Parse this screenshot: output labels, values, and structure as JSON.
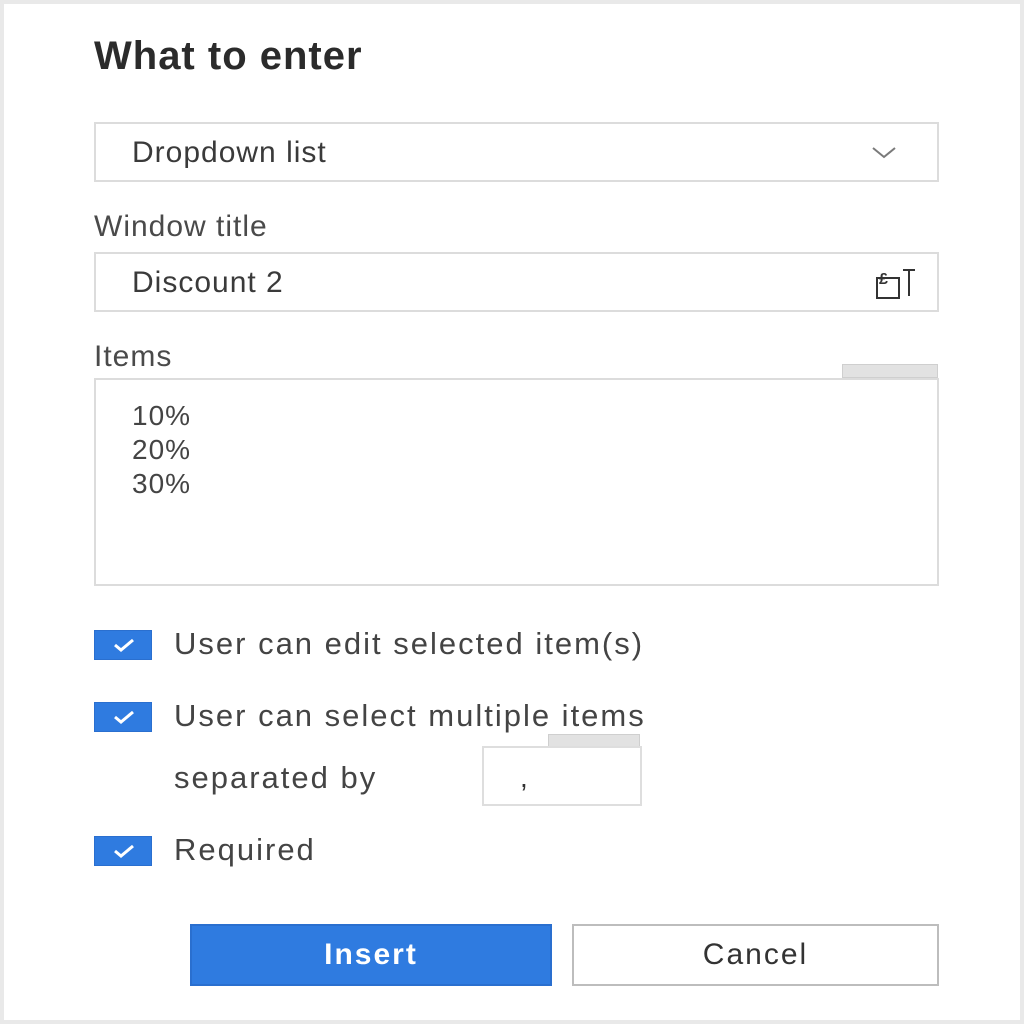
{
  "dialog": {
    "heading": "What to enter",
    "input_type": {
      "selected": "Dropdown list",
      "icon": "chevron-down-icon"
    },
    "window_title": {
      "label": "Window title",
      "value": "Discount 2",
      "icon": "insert-field-icon"
    },
    "items": {
      "label": "Items",
      "lines": [
        "10%",
        "20%",
        "30%"
      ]
    },
    "options": {
      "edit_selected": {
        "label": "User can edit selected item(s)",
        "checked": true
      },
      "select_multiple": {
        "label": "User can select multiple items",
        "checked": true
      },
      "separated_by_label": "separated by",
      "separator_value": ",",
      "required": {
        "label": "Required",
        "checked": true
      }
    },
    "buttons": {
      "insert": "Insert",
      "cancel": "Cancel"
    },
    "colors": {
      "accent": "#2f7be0",
      "border": "#dcdcdc",
      "text": "#3a3a3a"
    }
  }
}
